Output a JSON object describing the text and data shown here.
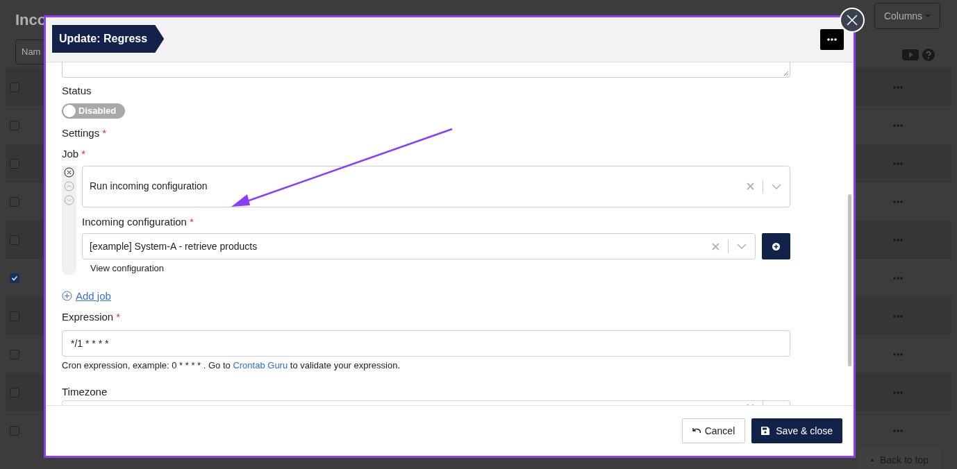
{
  "background": {
    "title": "Inco",
    "filter_button": "Nam",
    "columns_button": "Columns",
    "back_to_top": "Back to top",
    "rows": [
      {
        "checked": false
      },
      {
        "checked": false
      },
      {
        "checked": false
      },
      {
        "checked": false
      },
      {
        "checked": false
      },
      {
        "checked": true
      },
      {
        "checked": false
      },
      {
        "checked": false
      },
      {
        "checked": false
      },
      {
        "checked": false
      }
    ]
  },
  "dialog": {
    "title": "Update: Regress",
    "status": {
      "label": "Status",
      "on": false,
      "toggle_text": "Disabled"
    },
    "settings_label": "Settings",
    "settings_required": "*",
    "job": {
      "label": "Job",
      "required": "*",
      "value": "Run incoming configuration",
      "sub_field": {
        "label": "Incoming configuration",
        "required": "*",
        "value": "[example] System-A - retrieve products",
        "link": "View configuration"
      }
    },
    "add_job": "Add job",
    "expression": {
      "label": "Expression",
      "required": "*",
      "value": "*/1 * * * *",
      "help_before": "Cron expression, example: 0 * * * * . Go to ",
      "help_link": "Crontab Guru",
      "help_after": " to validate your expression."
    },
    "timezone": {
      "label": "Timezone"
    },
    "buttons": [
      {
        "kind": "cancel",
        "label": "Cancel"
      },
      {
        "kind": "save",
        "label": "Save & close"
      }
    ]
  }
}
